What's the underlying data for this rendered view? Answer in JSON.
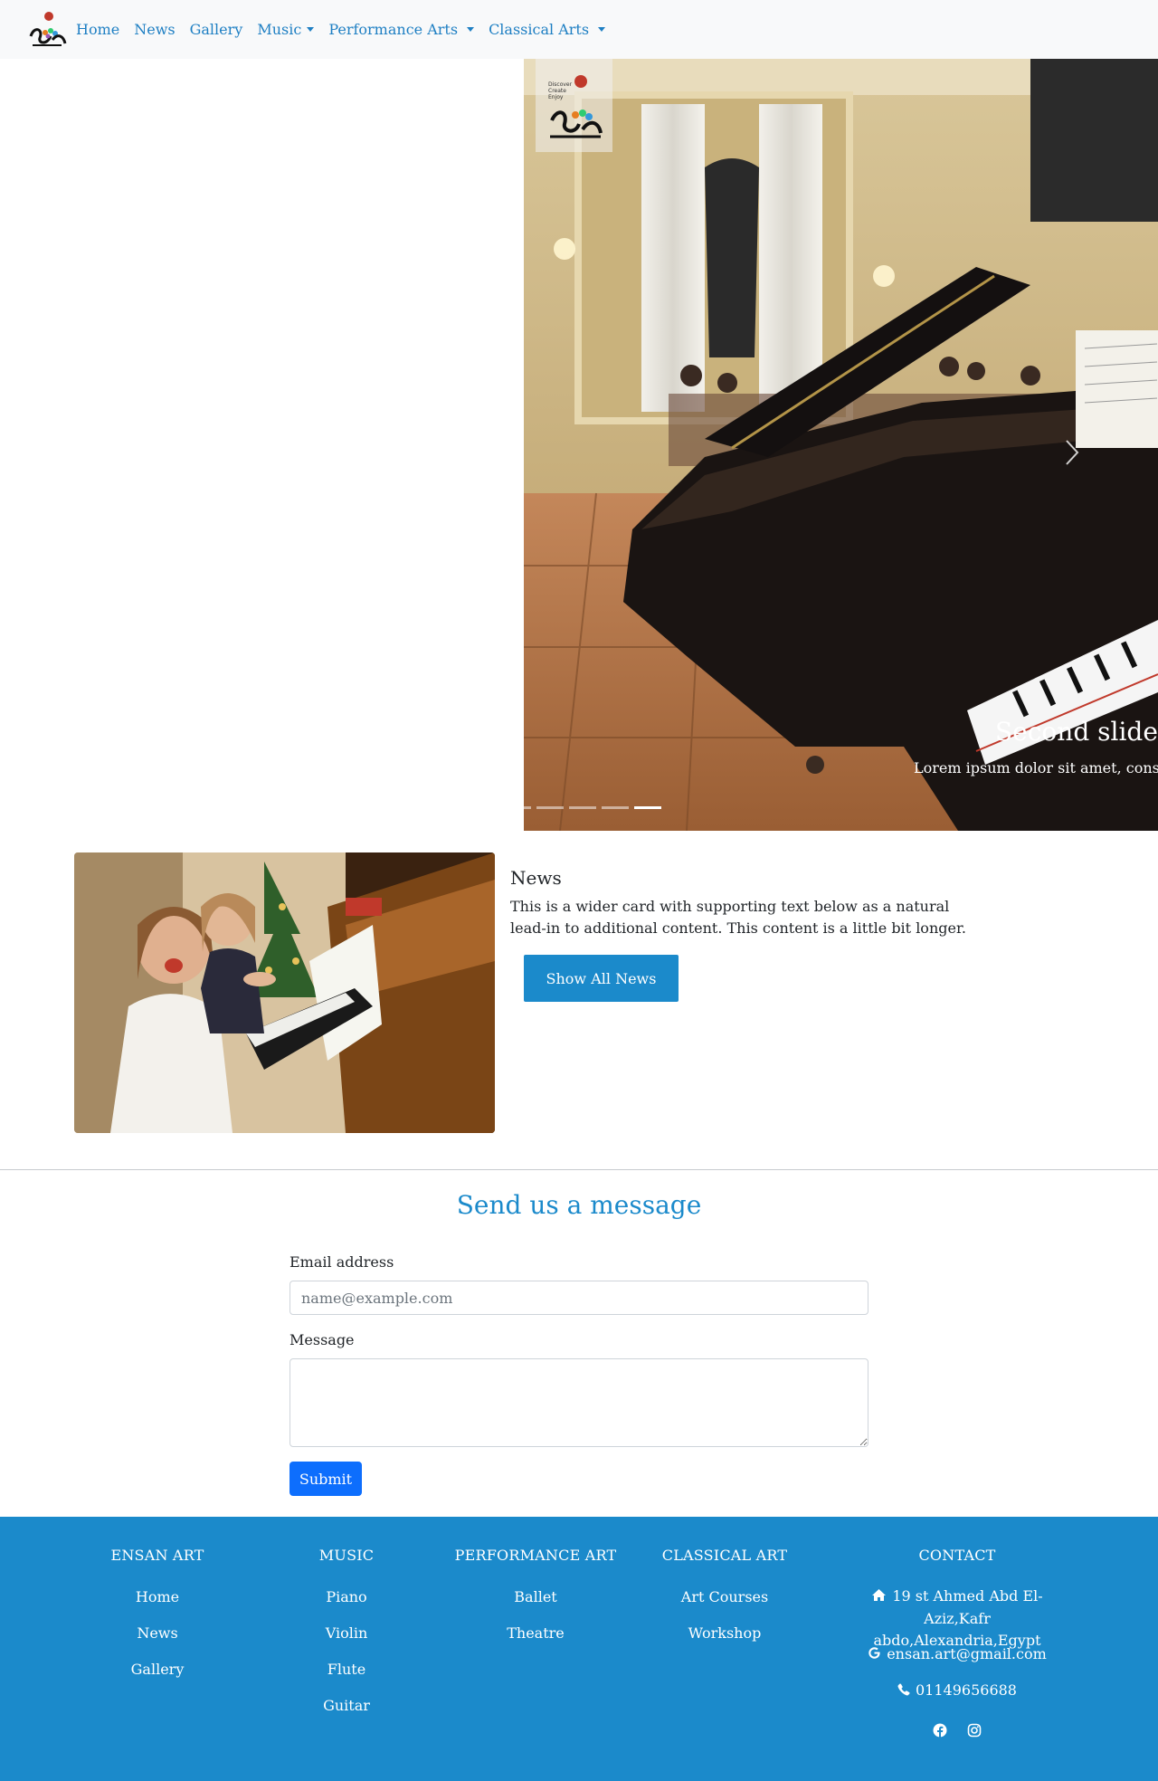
{
  "nav": {
    "items": [
      {
        "label": "Home",
        "dropdown": false
      },
      {
        "label": "News",
        "dropdown": false
      },
      {
        "label": "Gallery",
        "dropdown": false
      },
      {
        "label": "Music",
        "dropdown": true
      },
      {
        "label": "Performance Arts",
        "dropdown": true
      },
      {
        "label": "Classical Arts",
        "dropdown": true
      }
    ]
  },
  "carousel": {
    "caption_title": "Second slide l",
    "caption_text": "Lorem ipsum dolor sit amet, consect",
    "active_slide": 5,
    "slide_count": 5
  },
  "news": {
    "title": "News",
    "text": "This is a wider card with supporting text below as a natural lead-in to additional content. This content is a little bit longer.",
    "button": "Show All News"
  },
  "form": {
    "heading": "Send us a message",
    "email_label": "Email address",
    "email_placeholder": "name@example.com",
    "message_label": "Message",
    "submit": "Submit"
  },
  "footer": {
    "ensan": {
      "heading": "ENSAN ART",
      "links": [
        "Home",
        "News",
        "Gallery"
      ]
    },
    "music": {
      "heading": "MUSIC",
      "links": [
        "Piano",
        "Violin",
        "Flute",
        "Guitar"
      ]
    },
    "performance": {
      "heading": "PERFORMANCE ART",
      "links": [
        "Ballet",
        "Theatre"
      ]
    },
    "classical": {
      "heading": "CLASSICAL ART",
      "links": [
        "Art Courses",
        "Workshop"
      ]
    },
    "contact": {
      "heading": "CONTACT",
      "address": "19 st Ahmed Abd El-Aziz,Kafr abdo,Alexandria,Egypt",
      "email": "ensan.art@gmail.com",
      "phone": "01149656688"
    }
  },
  "colors": {
    "primary": "#1b8acb",
    "link": "#1e7fc3",
    "submit": "#0d6efd",
    "navbar_bg": "#f8f9fa"
  }
}
